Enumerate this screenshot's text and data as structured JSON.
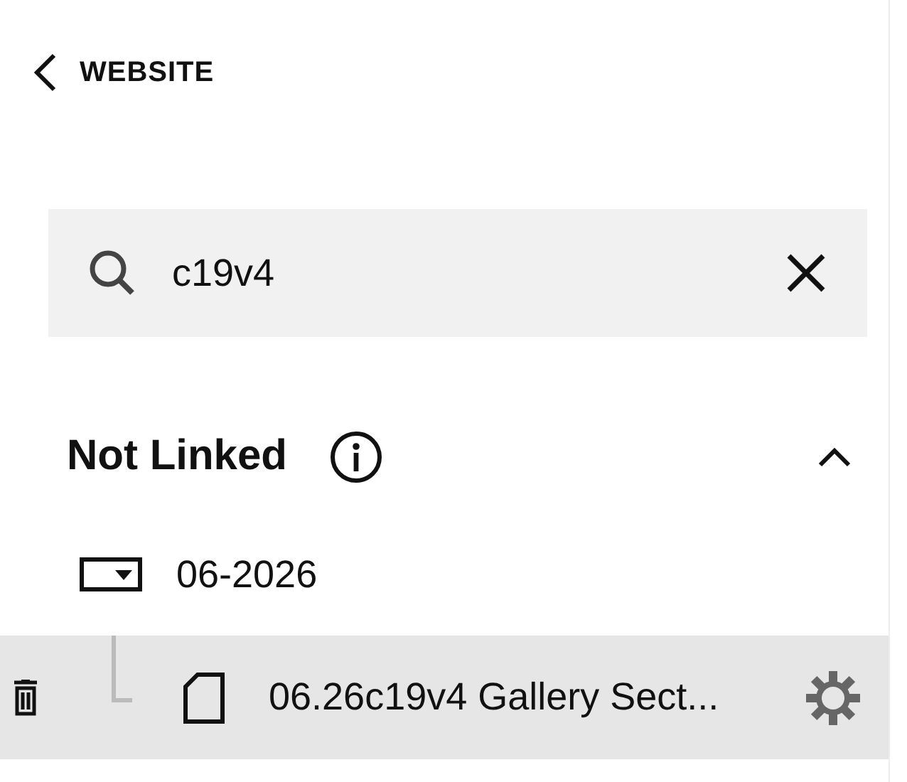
{
  "back_link": {
    "label": "WEBSITE"
  },
  "search": {
    "value": "c19v4"
  },
  "section": {
    "title": "Not Linked",
    "expanded": true
  },
  "tree": [
    {
      "kind": "folder",
      "label": "06-2026",
      "expanded": true,
      "selected": false,
      "children": [
        {
          "kind": "page",
          "label": "06.26c19v4 Gallery Sect...",
          "selected": true
        }
      ]
    }
  ]
}
